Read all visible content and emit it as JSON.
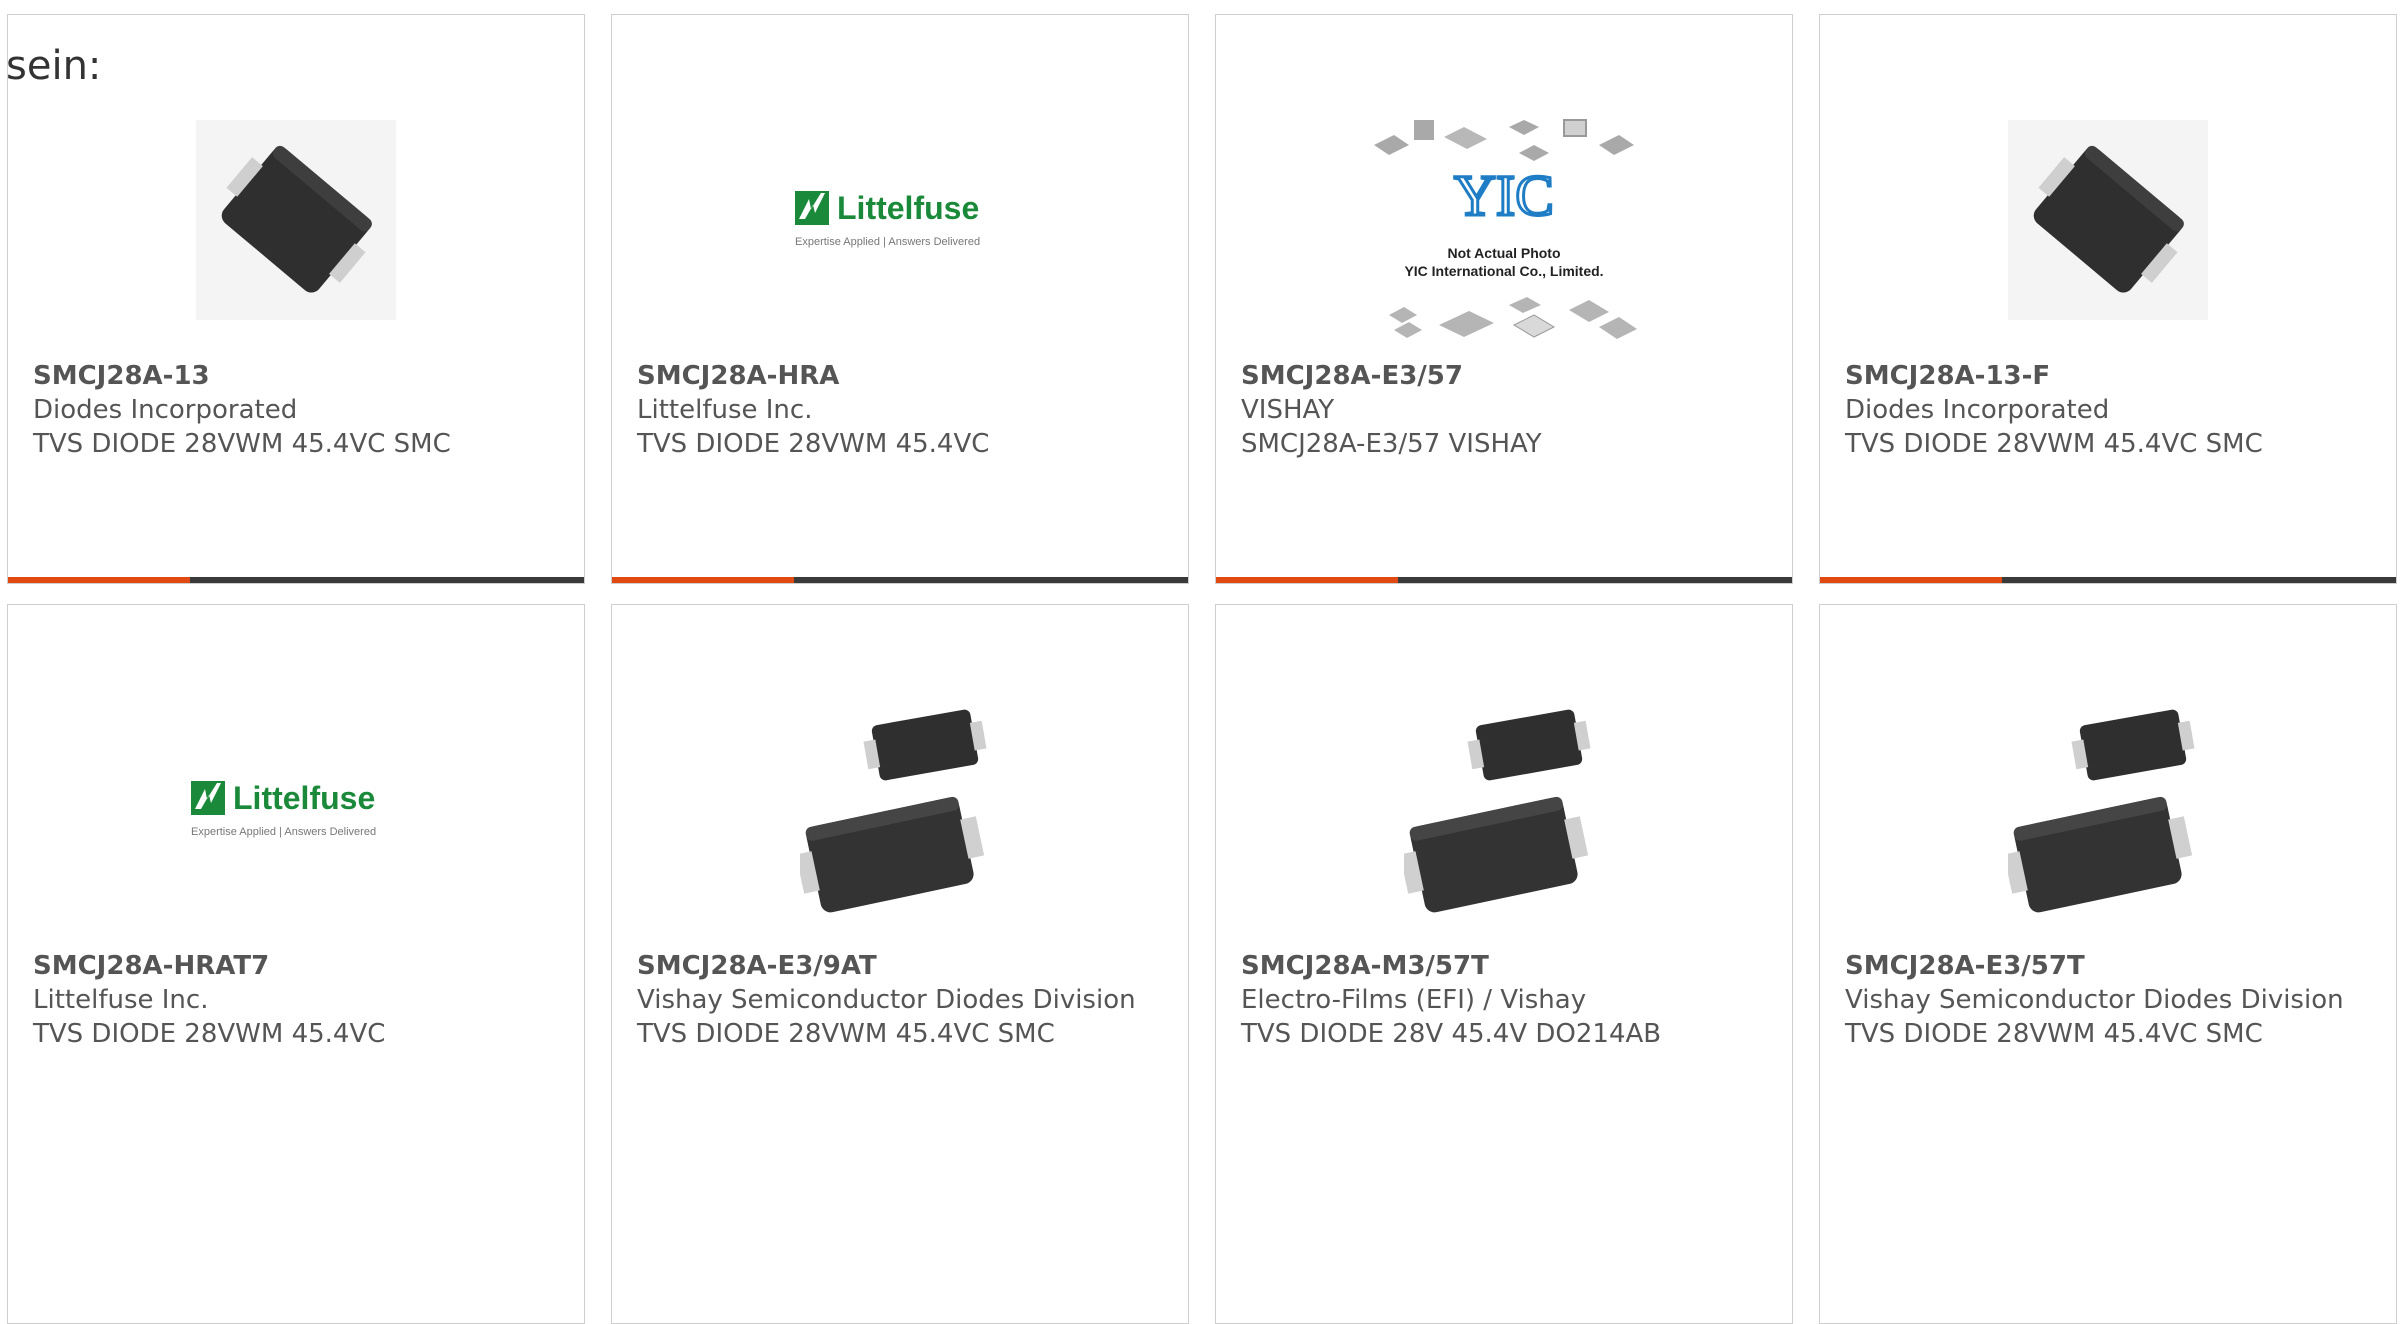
{
  "intro_text": "sein:",
  "colors": {
    "accent": "#e04a12",
    "bar": "#3a3a3a",
    "text": "#555555",
    "brand_green": "#1a8a3a"
  },
  "products": [
    {
      "part": "SMCJ28A-13",
      "manufacturer": "Diodes Incorporated",
      "description": "TVS DIODE 28VWM 45.4VC SMC",
      "image": "smc-diode-single-icon"
    },
    {
      "part": "SMCJ28A-HRA",
      "manufacturer": "Littelfuse Inc.",
      "description": "TVS DIODE 28VWM 45.4VC",
      "image": "littelfuse-logo",
      "logo_name": "Littelfuse",
      "logo_tagline": "Expertise Applied | Answers Delivered"
    },
    {
      "part": "SMCJ28A-E3/57",
      "manufacturer": "VISHAY",
      "description": "SMCJ28A-E3/57 VISHAY",
      "image": "yic-placeholder",
      "placeholder_lines": [
        "Not Actual Photo",
        "YIC International Co., Limited."
      ]
    },
    {
      "part": "SMCJ28A-13-F",
      "manufacturer": "Diodes Incorporated",
      "description": "TVS DIODE 28VWM 45.4VC SMC",
      "image": "smc-diode-single-icon"
    },
    {
      "part": "SMCJ28A-HRAT7",
      "manufacturer": "Littelfuse Inc.",
      "description": "TVS DIODE 28VWM 45.4VC",
      "image": "littelfuse-logo",
      "logo_name": "Littelfuse",
      "logo_tagline": "Expertise Applied | Answers Delivered"
    },
    {
      "part": "SMCJ28A-E3/9AT",
      "manufacturer": "Vishay Semiconductor Diodes Division",
      "description": "TVS DIODE 28VWM 45.4VC SMC",
      "image": "smc-diode-pair-icon"
    },
    {
      "part": "SMCJ28A-M3/57T",
      "manufacturer": "Electro-Films (EFI) / Vishay",
      "description": "TVS DIODE 28V 45.4V DO214AB",
      "image": "smc-diode-pair-icon"
    },
    {
      "part": "SMCJ28A-E3/57T",
      "manufacturer": "Vishay Semiconductor Diodes Division",
      "description": "TVS DIODE 28VWM 45.4VC SMC",
      "image": "smc-diode-pair-icon"
    }
  ]
}
